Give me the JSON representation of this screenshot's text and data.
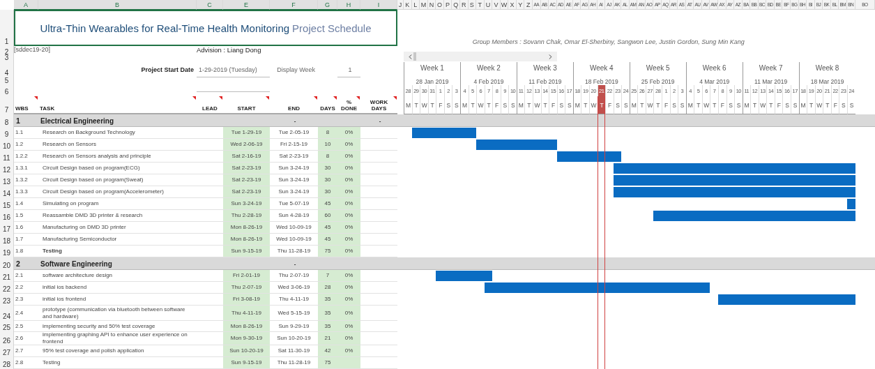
{
  "column_letters": [
    "A",
    "B",
    "C",
    "E",
    "F",
    "G",
    "H",
    "I",
    "J",
    "K",
    "L",
    "M",
    "N",
    "O",
    "P",
    "Q",
    "R",
    "S",
    "T",
    "U",
    "V",
    "W",
    "X",
    "Y",
    "Z",
    "AA",
    "AB",
    "AC",
    "AD",
    "AE",
    "AF",
    "AG",
    "AH",
    "AI",
    "AJ",
    "AK",
    "AL",
    "AM",
    "AN",
    "AO",
    "AP",
    "AQ",
    "AR",
    "AS",
    "AT",
    "AU",
    "AV",
    "AW",
    "AX",
    "AY",
    "AZ",
    "BA",
    "BB",
    "BC",
    "BD",
    "BE",
    "BF",
    "BG",
    "BH",
    "BI",
    "BJ",
    "BK",
    "BL",
    "BM",
    "BN",
    "BO"
  ],
  "row_numbers": [
    "1",
    "2",
    "3",
    "4",
    "5",
    "6",
    "7",
    "8",
    "9",
    "10",
    "11",
    "12",
    "13",
    "14",
    "15",
    "16",
    "17",
    "18",
    "19",
    "20",
    "21",
    "22",
    "23",
    "24",
    "25",
    "26",
    "27",
    "28"
  ],
  "title": {
    "main": "Ultra-Thin Wearables for Real-Time Health Monitoring",
    "suffix": "Project Schedule"
  },
  "group_members": "Group Members : Sovann Chak, Omar El-Sherbiny, Sangwon Lee, Justin Gordon, Sung Min Kang",
  "project_code": "[sddec19-20]",
  "advisor": "Advision : Liang Dong",
  "project_start": {
    "label": "Project Start Date",
    "value": "1-29-2019 (Tuesday)"
  },
  "display_week": {
    "label": "Display Week",
    "value": "1"
  },
  "weeks": [
    {
      "label": "Week 1",
      "date": "28 Jan 2019",
      "days": [
        {
          "number": "28",
          "letter": "M",
          "today": false
        },
        {
          "number": "29",
          "letter": "T",
          "today": false
        },
        {
          "number": "30",
          "letter": "W",
          "today": false
        },
        {
          "number": "31",
          "letter": "T",
          "today": false
        },
        {
          "number": "1",
          "letter": "F",
          "today": false
        },
        {
          "number": "2",
          "letter": "S",
          "today": false
        },
        {
          "number": "3",
          "letter": "S",
          "today": false
        }
      ]
    },
    {
      "label": "Week 2",
      "date": "4 Feb 2019",
      "days": [
        {
          "number": "4",
          "letter": "M",
          "today": false
        },
        {
          "number": "5",
          "letter": "T",
          "today": false
        },
        {
          "number": "6",
          "letter": "W",
          "today": false
        },
        {
          "number": "7",
          "letter": "T",
          "today": false
        },
        {
          "number": "8",
          "letter": "F",
          "today": false
        },
        {
          "number": "9",
          "letter": "S",
          "today": false
        },
        {
          "number": "10",
          "letter": "S",
          "today": false
        }
      ]
    },
    {
      "label": "Week 3",
      "date": "11 Feb 2019",
      "days": [
        {
          "number": "11",
          "letter": "M",
          "today": false
        },
        {
          "number": "12",
          "letter": "T",
          "today": false
        },
        {
          "number": "13",
          "letter": "W",
          "today": false
        },
        {
          "number": "14",
          "letter": "T",
          "today": false
        },
        {
          "number": "15",
          "letter": "F",
          "today": false
        },
        {
          "number": "16",
          "letter": "S",
          "today": false
        },
        {
          "number": "17",
          "letter": "S",
          "today": false
        }
      ]
    },
    {
      "label": "Week 4",
      "date": "18 Feb 2019",
      "days": [
        {
          "number": "18",
          "letter": "M",
          "today": false
        },
        {
          "number": "19",
          "letter": "T",
          "today": false
        },
        {
          "number": "20",
          "letter": "W",
          "today": false
        },
        {
          "number": "21",
          "letter": "T",
          "today": true
        },
        {
          "number": "22",
          "letter": "F",
          "today": false
        },
        {
          "number": "23",
          "letter": "S",
          "today": false
        },
        {
          "number": "24",
          "letter": "S",
          "today": false
        }
      ]
    },
    {
      "label": "Week 5",
      "date": "25 Feb 2019",
      "days": [
        {
          "number": "25",
          "letter": "M",
          "today": false
        },
        {
          "number": "26",
          "letter": "T",
          "today": false
        },
        {
          "number": "27",
          "letter": "W",
          "today": false
        },
        {
          "number": "28",
          "letter": "T",
          "today": false
        },
        {
          "number": "1",
          "letter": "F",
          "today": false
        },
        {
          "number": "2",
          "letter": "S",
          "today": false
        },
        {
          "number": "3",
          "letter": "S",
          "today": false
        }
      ]
    },
    {
      "label": "Week 6",
      "date": "4 Mar 2019",
      "days": [
        {
          "number": "4",
          "letter": "M",
          "today": false
        },
        {
          "number": "5",
          "letter": "T",
          "today": false
        },
        {
          "number": "6",
          "letter": "W",
          "today": false
        },
        {
          "number": "7",
          "letter": "T",
          "today": false
        },
        {
          "number": "8",
          "letter": "F",
          "today": false
        },
        {
          "number": "9",
          "letter": "S",
          "today": false
        },
        {
          "number": "10",
          "letter": "S",
          "today": false
        }
      ]
    },
    {
      "label": "Week 7",
      "date": "11 Mar 2019",
      "days": [
        {
          "number": "11",
          "letter": "M",
          "today": false
        },
        {
          "number": "12",
          "letter": "T",
          "today": false
        },
        {
          "number": "13",
          "letter": "W",
          "today": false
        },
        {
          "number": "14",
          "letter": "T",
          "today": false
        },
        {
          "number": "15",
          "letter": "F",
          "today": false
        },
        {
          "number": "16",
          "letter": "S",
          "today": false
        },
        {
          "number": "17",
          "letter": "S",
          "today": false
        }
      ]
    },
    {
      "label": "Week 8",
      "date": "18 Mar 2019",
      "days": [
        {
          "number": "18",
          "letter": "M",
          "today": false
        },
        {
          "number": "19",
          "letter": "T",
          "today": false
        },
        {
          "number": "20",
          "letter": "W",
          "today": false
        },
        {
          "number": "21",
          "letter": "T",
          "today": false
        },
        {
          "number": "22",
          "letter": "F",
          "today": false
        },
        {
          "number": "23",
          "letter": "S",
          "today": false
        },
        {
          "number": "24",
          "letter": "S",
          "today": false
        }
      ]
    }
  ],
  "columns": [
    {
      "label": "WBS",
      "comment": true
    },
    {
      "label": "TASK",
      "comment": true
    },
    {
      "label": "LEAD",
      "comment": true
    },
    {
      "label": "START",
      "comment": true
    },
    {
      "label": "END",
      "comment": true
    },
    {
      "label": "DAYS",
      "comment": true
    },
    {
      "label": "% DONE",
      "comment": true
    },
    {
      "label": "WORK DAYS",
      "comment": true
    }
  ],
  "sections": [
    {
      "number": "1",
      "title": "Electrical Engineering",
      "end": "-",
      "work_days": "-",
      "tasks": [
        {
          "wbs": "1.1",
          "task": "Research on Background Technology",
          "start": "Tue 1-29-19",
          "end": "Tue 2-05-19",
          "days": "8",
          "done": "0%",
          "bold": false
        },
        {
          "wbs": "1.2",
          "task": "Research on Sensors",
          "start": "Wed 2-06-19",
          "end": "Fri 2-15-19",
          "days": "10",
          "done": "0%",
          "bold": false
        },
        {
          "wbs": "1.2.2",
          "task": "Research on Sensors analysis and principle",
          "start": "Sat 2-16-19",
          "end": "Sat 2-23-19",
          "days": "8",
          "done": "0%",
          "bold": false
        },
        {
          "wbs": "1.3.1",
          "task": "Circuit Design based on program(ECG)",
          "start": "Sat 2-23-19",
          "end": "Sun 3-24-19",
          "days": "30",
          "done": "0%",
          "bold": false
        },
        {
          "wbs": "1.3.2",
          "task": "Circuit Design based on program(Sweat)",
          "start": "Sat 2-23-19",
          "end": "Sun 3-24-19",
          "days": "30",
          "done": "0%",
          "bold": false
        },
        {
          "wbs": "1.3.3",
          "task": "Circuit Design based on program(Accelerometer)",
          "start": "Sat 2-23-19",
          "end": "Sun 3-24-19",
          "days": "30",
          "done": "0%",
          "bold": false
        },
        {
          "wbs": "1.4",
          "task": "Simulating on program",
          "start": "Sun 3-24-19",
          "end": "Tue 5-07-19",
          "days": "45",
          "done": "0%",
          "bold": false
        },
        {
          "wbs": "1.5",
          "task": "Reassamble DMD 3D printer & research",
          "start": "Thu 2-28-19",
          "end": "Sun 4-28-19",
          "days": "60",
          "done": "0%",
          "bold": false
        },
        {
          "wbs": "1.6",
          "task": "Manufacturing on DMD 3D printer",
          "start": "Mon 8-26-19",
          "end": "Wed 10-09-19",
          "days": "45",
          "done": "0%",
          "bold": false
        },
        {
          "wbs": "1.7",
          "task": "Manufacturing Semiconductor",
          "start": "Mon 8-26-19",
          "end": "Wed 10-09-19",
          "days": "45",
          "done": "0%",
          "bold": false
        },
        {
          "wbs": "1.8",
          "task": "Testing",
          "start": "Sun 9-15-19",
          "end": "Thu 11-28-19",
          "days": "75",
          "done": "0%",
          "bold": true
        }
      ]
    },
    {
      "number": "2",
      "title": "Software Engineering",
      "end": "-",
      "tasks": [
        {
          "wbs": "2.1",
          "task": "software architecture design",
          "start": "Fri 2-01-19",
          "end": "Thu 2-07-19",
          "days": "7",
          "done": "0%",
          "bold": false
        },
        {
          "wbs": "2.2",
          "task": "initial ios backend",
          "start": "Thu 2-07-19",
          "end": "Wed 3-06-19",
          "days": "28",
          "done": "0%",
          "bold": false
        },
        {
          "wbs": "2.3",
          "task": "initial ios frontend",
          "start": "Fri 3-08-19",
          "end": "Thu 4-11-19",
          "days": "35",
          "done": "0%",
          "bold": false
        },
        {
          "wbs": "2.4",
          "task": "prototype (communication via bluetooth between software and hardware)",
          "start": "Thu 4-11-19",
          "end": "Wed 5-15-19",
          "days": "35",
          "done": "0%",
          "bold": false
        },
        {
          "wbs": "2.5",
          "task": "implementing security and 50% test coverage",
          "start": "Mon 8-26-19",
          "end": "Sun 9-29-19",
          "days": "35",
          "done": "0%",
          "bold": false
        },
        {
          "wbs": "2.6",
          "task": "implementing graphing API to enhance user experience on frontend",
          "start": "Mon 9-30-19",
          "end": "Sun 10-20-19",
          "days": "21",
          "done": "0%",
          "bold": false
        },
        {
          "wbs": "2.7",
          "task": "95% test coverage and polish application",
          "start": "Sun 10-20-19",
          "end": "Sat 11-30-19",
          "days": "42",
          "done": "0%",
          "bold": false
        },
        {
          "wbs": "2.8",
          "task": "Testing",
          "start": "Sun 9-15-19",
          "end": "Thu 11-28-19",
          "days": "75",
          "bold": false
        }
      ]
    }
  ]
}
